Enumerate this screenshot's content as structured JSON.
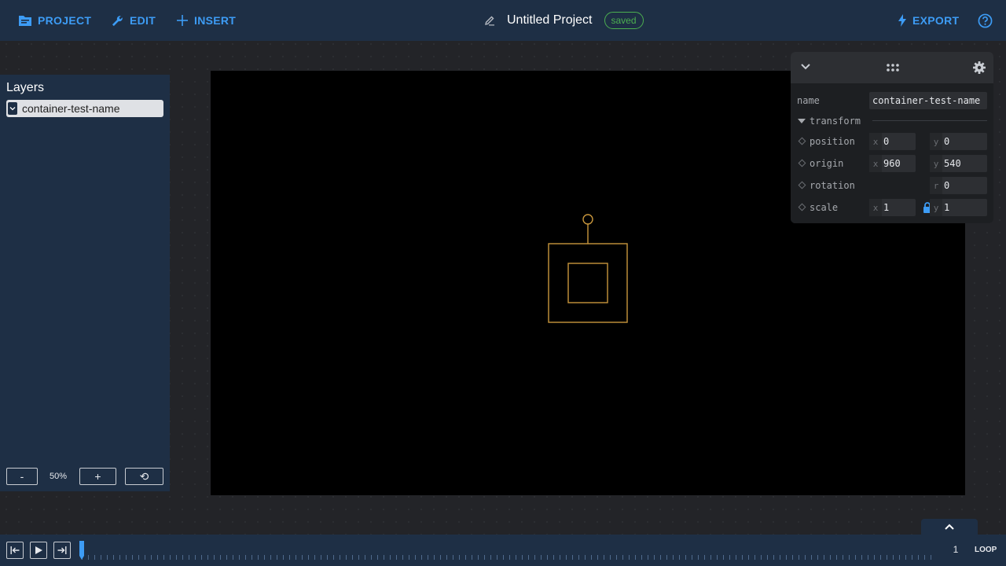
{
  "menu": {
    "project": "PROJECT",
    "edit": "EDIT",
    "insert": "INSERT",
    "export": "EXPORT"
  },
  "project": {
    "title": "Untitled Project",
    "status": "saved"
  },
  "layers": {
    "title": "Layers",
    "items": [
      {
        "name": "container-test-name"
      }
    ]
  },
  "zoom": {
    "minus": "-",
    "level": "50%",
    "plus": "+",
    "reset": "⟲"
  },
  "inspector": {
    "name_label": "name",
    "name_value": "container-test-name",
    "section": "transform",
    "props": {
      "position": {
        "label": "position",
        "x": "0",
        "y": "0"
      },
      "origin": {
        "label": "origin",
        "x": "960",
        "y": "540"
      },
      "rotation": {
        "label": "rotation",
        "r": "0"
      },
      "scale": {
        "label": "scale",
        "x": "1",
        "y": "1"
      }
    },
    "axes": {
      "x": "x",
      "y": "y",
      "r": "r"
    }
  },
  "timeline": {
    "frame": "1",
    "loop": "LOOP"
  },
  "colors": {
    "accent": "#3d9cf5",
    "saved": "#4caf50",
    "selection": "#c8963c",
    "panel": "#1e2f45"
  },
  "icons": {
    "project": "folder-icon",
    "edit": "wrench-icon",
    "insert": "plus-icon",
    "export": "lightning-icon",
    "help": "help-icon",
    "rename": "pencil-icon",
    "collapse": "chevron-down-icon",
    "drag": "drag-handle-icon",
    "settings": "gear-icon",
    "lock": "lock-icon"
  }
}
